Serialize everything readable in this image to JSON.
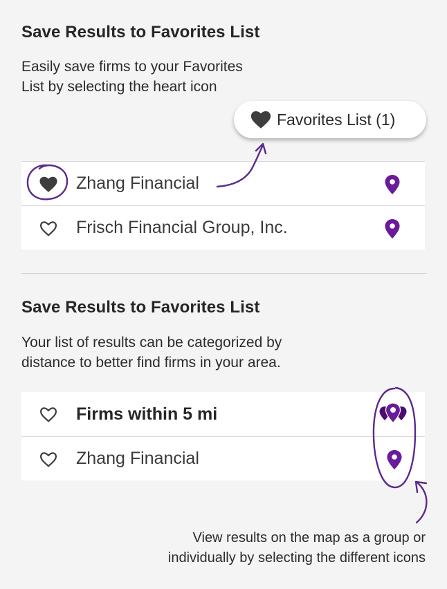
{
  "section1": {
    "title": "Save Results to Favorites List",
    "desc_line1": "Easily save firms to your Favorites",
    "desc_line2": "List by selecting the heart icon",
    "favorites_button_label": "Favorites List (1)",
    "rows": [
      {
        "label": "Zhang Financial",
        "favorited": true,
        "pin_icon": "map-pin-icon"
      },
      {
        "label": "Frisch Financial Group, Inc.",
        "favorited": false,
        "pin_icon": "map-pin-icon"
      }
    ]
  },
  "section2": {
    "title": "Save Results to Favorites List",
    "desc_line1": "Your list of results can be categorized by",
    "desc_line2": "distance to better find firms in your area.",
    "rows": [
      {
        "label": "Firms within 5 mi",
        "favorited": false,
        "pin_icon": "map-pin-group-icon"
      },
      {
        "label": "Zhang Financial",
        "favorited": false,
        "pin_icon": "map-pin-icon"
      }
    ],
    "caption_line1": "View results on the map as a group or",
    "caption_line2": "individually by selecting the different icons"
  },
  "colors": {
    "accent_purple": "#6a1b9a",
    "heart_dark": "#3d3d3d",
    "annotation_purple": "#5b2a8c",
    "background": "#f4f4f4"
  }
}
